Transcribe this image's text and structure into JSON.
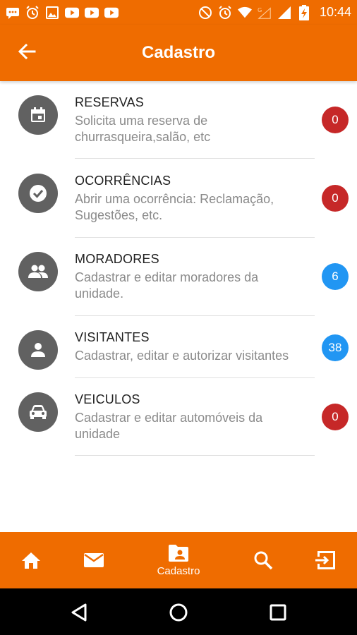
{
  "status_bar": {
    "time": "10:44",
    "left_icons": [
      "message-icon",
      "alarm-icon",
      "image-icon",
      "youtube-icon",
      "youtube-icon",
      "youtube-icon"
    ],
    "right_icons": [
      "do-not-disturb-icon",
      "alarm-icon",
      "wifi-icon",
      "signal-g-icon",
      "signal-icon",
      "battery-charging-icon"
    ]
  },
  "app_bar": {
    "title": "Cadastro",
    "back_icon": "arrow-back-icon"
  },
  "items": [
    {
      "title": "RESERVAS",
      "subtitle_line1": "Solicita uma reserva de",
      "subtitle_line2": "churrasqueira,salão, etc",
      "badge": "0",
      "icon": "calendar-icon",
      "badge_color": "#c62828"
    },
    {
      "title": "OCORRÊNCIAS",
      "subtitle_line1": "Abrir uma ocorrência: Reclamação,",
      "subtitle_line2": "Sugestões, etc.",
      "badge": "0",
      "icon": "check-circle-icon",
      "badge_color": "#c62828"
    },
    {
      "title": "MORADORES",
      "subtitle_line1": "Cadastrar e editar moradores da",
      "subtitle_line2": "unidade.",
      "badge": "6",
      "icon": "people-icon",
      "badge_color": "#2196f3"
    },
    {
      "title": "VISITANTES",
      "subtitle_line1": "Cadastrar, editar e autorizar visitantes",
      "subtitle_line2": "",
      "badge": "38",
      "icon": "person-icon",
      "badge_color": "#2196f3"
    },
    {
      "title": "VEICULOS",
      "subtitle_line1": "Cadastrar e editar automóveis da",
      "subtitle_line2": "unidade",
      "badge": "0",
      "icon": "car-icon",
      "badge_color": "#c62828"
    }
  ],
  "bottom_nav": {
    "active_label": "Cadastro",
    "items": [
      "home-icon",
      "mail-icon",
      "contact-folder-icon",
      "search-icon",
      "exit-icon"
    ]
  },
  "colors": {
    "primary": "#ef6c00",
    "icon_bg": "#616161",
    "badge_red": "#c62828",
    "badge_blue": "#2196f3"
  }
}
